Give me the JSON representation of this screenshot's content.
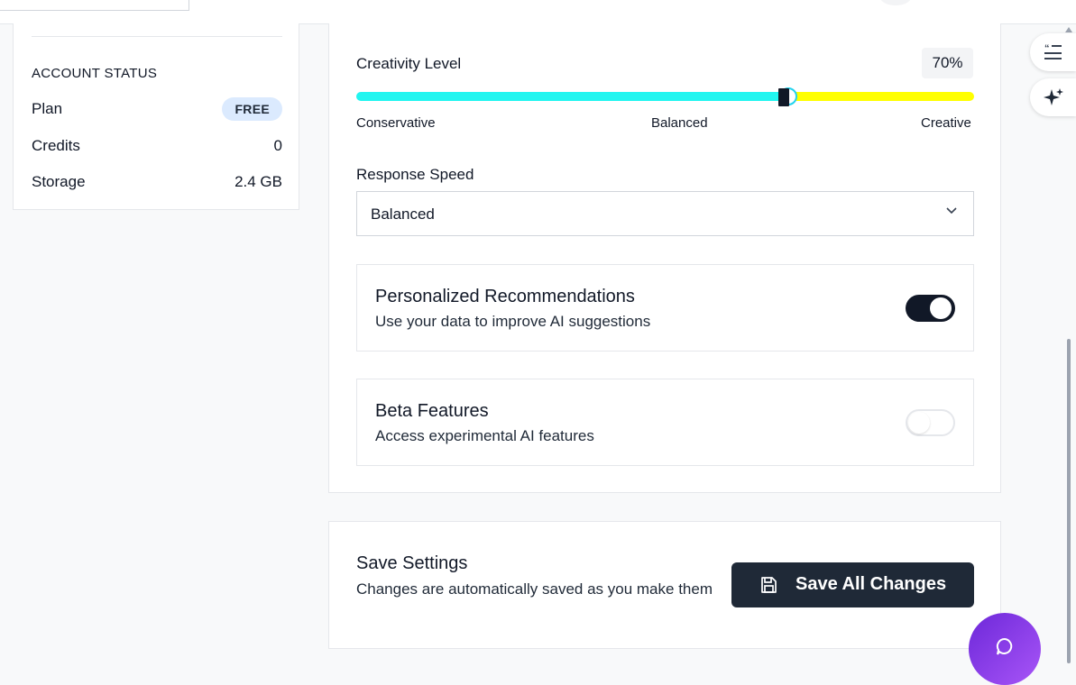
{
  "account_status": {
    "heading": "ACCOUNT STATUS",
    "rows": [
      {
        "label": "Plan",
        "value": "FREE"
      },
      {
        "label": "Credits",
        "value": "0"
      },
      {
        "label": "Storage",
        "value": "2.4 GB"
      }
    ]
  },
  "creativity": {
    "label": "Creativity Level",
    "value_text": "70%",
    "value": 70,
    "ticks": [
      "Conservative",
      "Balanced",
      "Creative"
    ],
    "colors": {
      "filled": "#22f5f0",
      "remaining": "#ffff00"
    }
  },
  "response_speed": {
    "label": "Response Speed",
    "selected": "Balanced"
  },
  "toggles": [
    {
      "title": "Personalized Recommendations",
      "description": "Use your data to improve AI suggestions",
      "on": true
    },
    {
      "title": "Beta Features",
      "description": "Access experimental AI features",
      "on": false
    }
  ],
  "save": {
    "title": "Save Settings",
    "description": "Changes are automatically saved as you make them",
    "button_label": "Save All Changes",
    "button_icon": "floppy-disk-icon"
  },
  "side_tools": [
    "quote-list-icon",
    "sparkles-icon"
  ],
  "chat_icon": "chat-bubble-icon",
  "theme": {
    "primary_dark": "#1f2937",
    "accent_purple": "#7c3aed"
  }
}
